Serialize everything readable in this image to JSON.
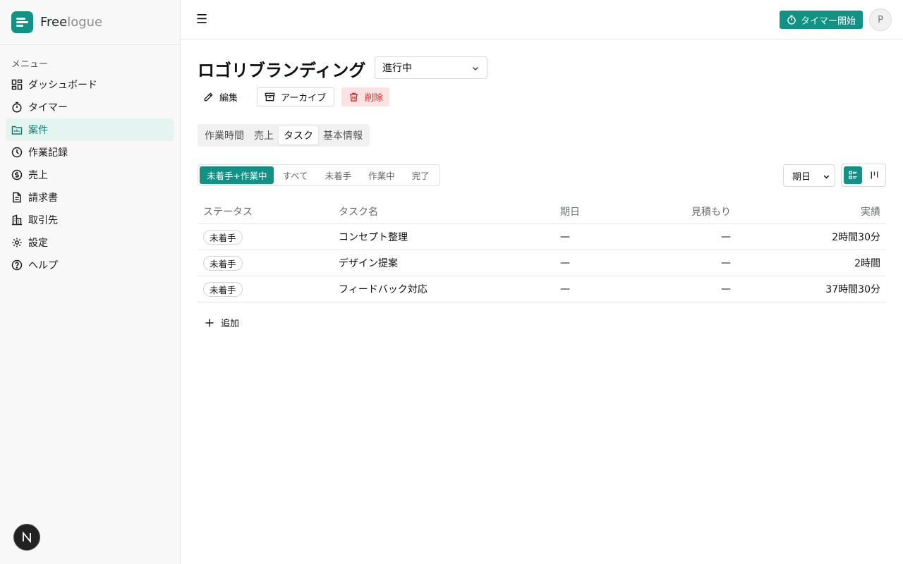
{
  "app": {
    "name_primary": "Free",
    "name_secondary": "logue",
    "accent": "#109285"
  },
  "sidebar": {
    "menu_label": "メニュー",
    "items": [
      {
        "label": "ダッシュボード",
        "icon": "dashboard-icon"
      },
      {
        "label": "タイマー",
        "icon": "stopwatch-icon"
      },
      {
        "label": "案件",
        "icon": "folder-icon",
        "active": true
      },
      {
        "label": "作業記録",
        "icon": "clock-icon"
      },
      {
        "label": "売上",
        "icon": "dollar-icon"
      },
      {
        "label": "請求書",
        "icon": "document-icon"
      },
      {
        "label": "取引先",
        "icon": "building-icon"
      },
      {
        "label": "設定",
        "icon": "gear-icon"
      },
      {
        "label": "ヘルプ",
        "icon": "help-icon"
      }
    ],
    "badge_letter": "N"
  },
  "topbar": {
    "menu_glyph": "☰",
    "timer_label": "タイマー開始",
    "avatar_letter": "P"
  },
  "project": {
    "title": "ロゴリブランディング",
    "status": "進行中"
  },
  "actions": {
    "edit": "編集",
    "archive": "アーカイブ",
    "delete": "削除"
  },
  "tabs": [
    "作業時間",
    "売上",
    "タスク",
    "基本情報"
  ],
  "active_tab": "タスク",
  "filters": [
    "未着手+作業中",
    "すべて",
    "未着手",
    "作業中",
    "完了"
  ],
  "active_filter": "未着手+作業中",
  "sort": {
    "selected": "期日"
  },
  "table": {
    "headers": {
      "status": "ステータス",
      "name": "タスク名",
      "due": "期日",
      "estimate": "見積もり",
      "actual": "実績"
    },
    "rows": [
      {
        "status": "未着手",
        "name": "コンセプト整理",
        "due": "—",
        "estimate": "—",
        "actual": "2時間30分"
      },
      {
        "status": "未着手",
        "name": "デザイン提案",
        "due": "—",
        "estimate": "—",
        "actual": "2時間"
      },
      {
        "status": "未着手",
        "name": "フィードバック対応",
        "due": "—",
        "estimate": "—",
        "actual": "37時間30分"
      }
    ]
  },
  "add_label": "追加"
}
